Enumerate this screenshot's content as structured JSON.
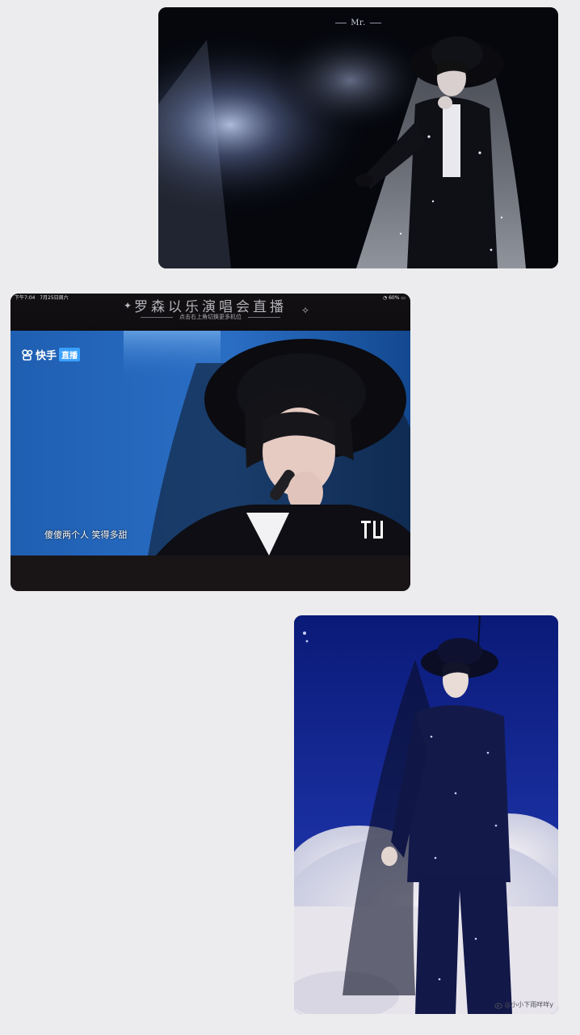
{
  "photo1": {
    "watermark": "Mr."
  },
  "photo2": {
    "status_time": "下午7:04",
    "status_date": "7月25日周六",
    "status_battery": "60%",
    "banner_title": "罗森以乐演唱会直播",
    "banner_subtitle": "点击右上角切换更多机位",
    "brand_name": "快手",
    "brand_tag": "直播",
    "subtitle": "傻傻两个人 笑得多甜"
  },
  "photo3": {
    "credit": "@小小下雨咩咩y"
  }
}
